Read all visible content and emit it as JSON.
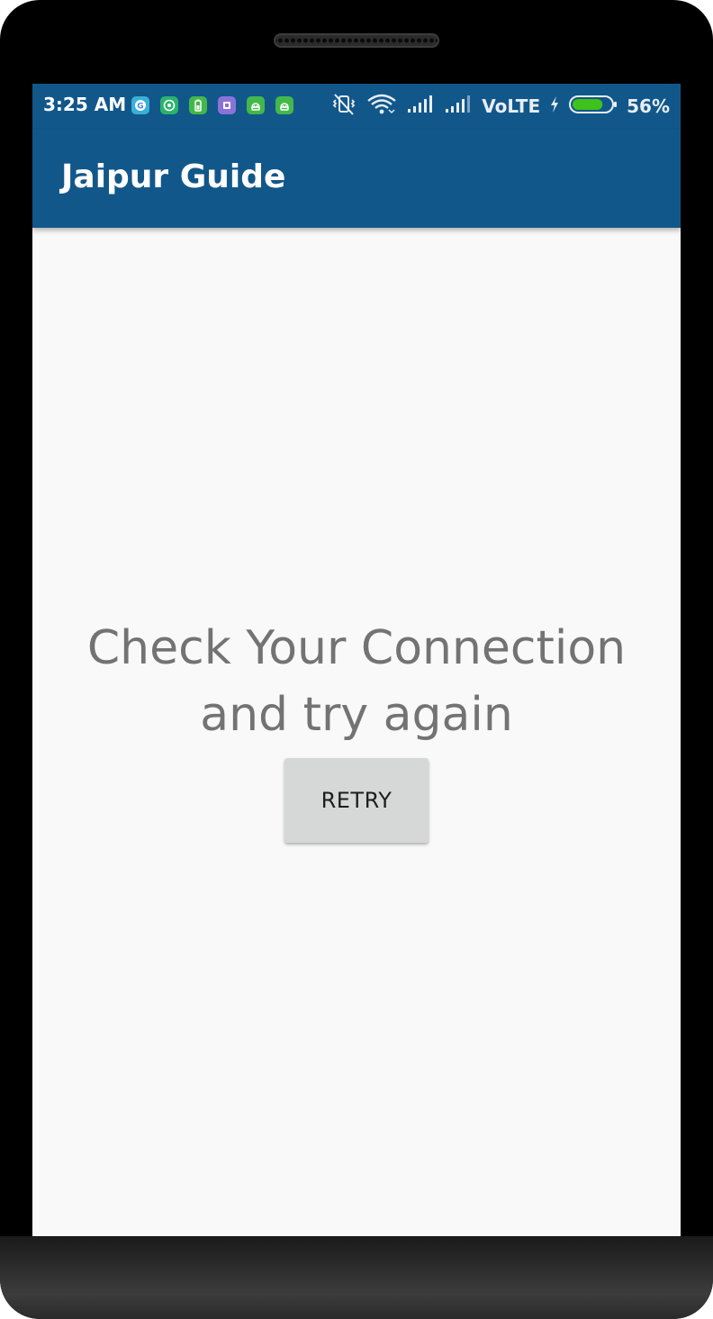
{
  "status_bar": {
    "time": "3:25 AM",
    "network": "VoLTE",
    "battery_percent": "56%",
    "battery_level": 0.56,
    "notification_icons": [
      "google-icon",
      "whatsapp-icon",
      "battery-saver-icon",
      "app-icon",
      "android-icon",
      "android-icon"
    ]
  },
  "toolbar": {
    "title": "Jaipur Guide",
    "color": "#12578a"
  },
  "content": {
    "message_line1": "Check Your Connection",
    "message_line2": "and try again",
    "retry_label": "RETRY"
  }
}
